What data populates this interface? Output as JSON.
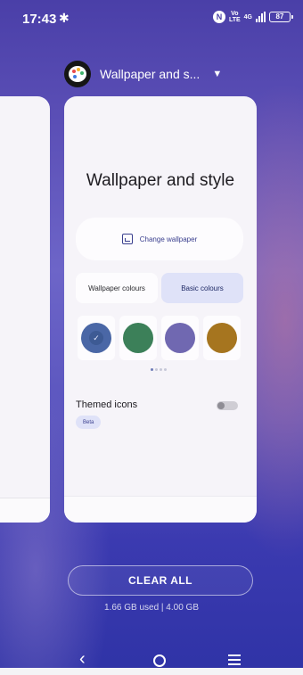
{
  "status_bar": {
    "time": "17:43",
    "volte_top": "Vo",
    "volte_bottom": "LTE",
    "network": "4G",
    "battery": "87"
  },
  "app": {
    "title": "Wallpaper and s..."
  },
  "card": {
    "page_title": "Wallpaper and style",
    "change_wallpaper": "Change wallpaper",
    "tabs": [
      {
        "label": "Wallpaper colours",
        "selected": false
      },
      {
        "label": "Basic colours",
        "selected": true
      }
    ],
    "swatches": [
      {
        "color": "#4a67a6",
        "selected": true
      },
      {
        "color": "#3c8059",
        "selected": false
      },
      {
        "color": "#7068b1",
        "selected": false
      },
      {
        "color": "#a6751f",
        "selected": false
      }
    ],
    "themed_icons_label": "Themed icons",
    "beta_badge": "Beta",
    "themed_icons_enabled": false
  },
  "recents": {
    "clear_all": "CLEAR ALL",
    "memory": "1.66 GB used | 4.00 GB"
  },
  "nav": {
    "back_glyph": "‹"
  }
}
